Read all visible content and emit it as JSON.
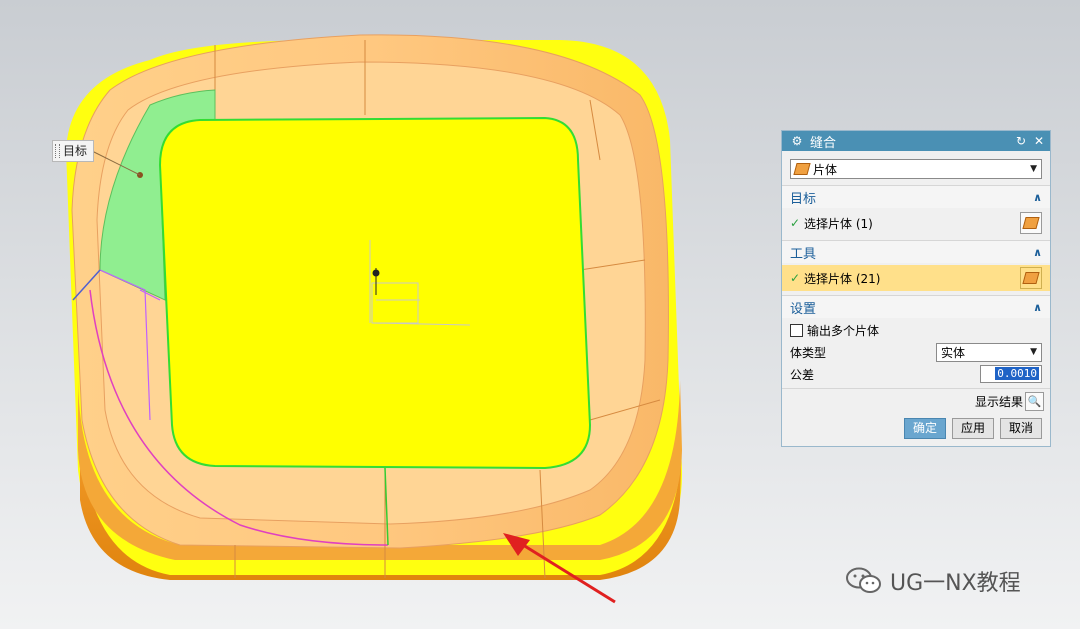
{
  "viewport": {
    "target_tag": "目标"
  },
  "dialog": {
    "title": "缝合",
    "type_value": "片体",
    "target_section": {
      "title": "目标",
      "selection": "选择片体 (1)"
    },
    "tool_section": {
      "title": "工具",
      "selection": "选择片体 (21)"
    },
    "settings_section": {
      "title": "设置",
      "multi_output_label": "输出多个片体",
      "body_type_label": "体类型",
      "body_type_value": "实体",
      "tolerance_label": "公差",
      "tolerance_value": "0.0010"
    },
    "show_result_label": "显示结果",
    "ok_label": "确定",
    "apply_label": "应用",
    "cancel_label": "取消"
  },
  "watermark": {
    "text": "UG一NX教程"
  },
  "colors": {
    "accent": "#4a90b4",
    "active_row": "#ffe08a",
    "model_yellow": "#ffff00",
    "model_orange": "#f0a030"
  }
}
